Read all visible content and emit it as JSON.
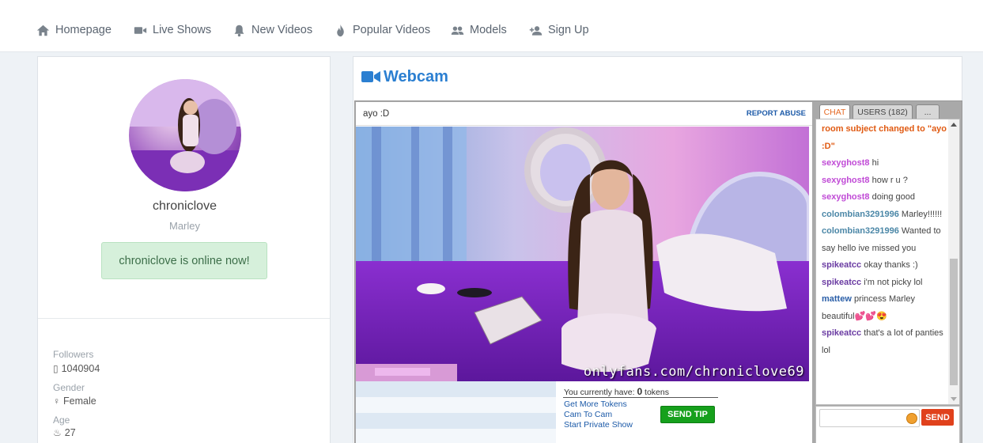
{
  "nav": {
    "items": [
      {
        "label": "Homepage",
        "icon": "home-icon"
      },
      {
        "label": "Live Shows",
        "icon": "video-camera-icon"
      },
      {
        "label": "New Videos",
        "icon": "bell-icon"
      },
      {
        "label": "Popular Videos",
        "icon": "fire-icon"
      },
      {
        "label": "Models",
        "icon": "users-icon"
      },
      {
        "label": "Sign Up",
        "icon": "user-plus-icon"
      }
    ]
  },
  "profile": {
    "username": "chroniclove",
    "realname": "Marley",
    "status": "chroniclove is online now!",
    "stats": {
      "followers_label": "Followers",
      "followers_value": "1040904",
      "gender_label": "Gender",
      "gender_value": "Female",
      "age_label": "Age",
      "age_value": "27"
    }
  },
  "webcam": {
    "title": "Webcam",
    "subject": "ayo :D",
    "report": "REPORT ABUSE",
    "watermark": "onlyfans.com/chroniclove69",
    "tokens_prefix": "You currently have:",
    "tokens_count": "0",
    "tokens_suffix": "tokens",
    "links": [
      "Get More Tokens",
      "Cam To Cam",
      "Start Private Show"
    ],
    "tip_button": "SEND TIP"
  },
  "chat": {
    "tabs": [
      "CHAT",
      "USERS (182)",
      "..."
    ],
    "messages": [
      {
        "user": "",
        "text": "room subject changed to \"ayo :D\"",
        "type": "sys"
      },
      {
        "user": "sexyghost8",
        "text": "hi",
        "type": "pink"
      },
      {
        "user": "sexyghost8",
        "text": "how r u ?",
        "type": "pink"
      },
      {
        "user": "sexyghost8",
        "text": "doing good",
        "type": "pink"
      },
      {
        "user": "colombian3291996",
        "text": "Marley!!!!!!",
        "type": "teal"
      },
      {
        "user": "colombian3291996",
        "text": "Wanted to say hello ive missed you",
        "type": "teal"
      },
      {
        "user": "spikeatcc",
        "text": "okay thanks :)",
        "type": "purple"
      },
      {
        "user": "spikeatcc",
        "text": "i'm not picky lol",
        "type": "purple"
      },
      {
        "user": "mattew",
        "text": "princess Marley beautiful💕💕😍",
        "type": "blue"
      },
      {
        "user": "spikeatcc",
        "text": "that's a lot of panties lol",
        "type": "purple"
      }
    ],
    "send_button": "SEND"
  },
  "colors": {
    "accent": "#2b7fd1",
    "online_bg": "#d6f0db",
    "tip_green": "#16a01c",
    "send_red": "#e0411c",
    "chat_tab_active": "#e56a25"
  }
}
